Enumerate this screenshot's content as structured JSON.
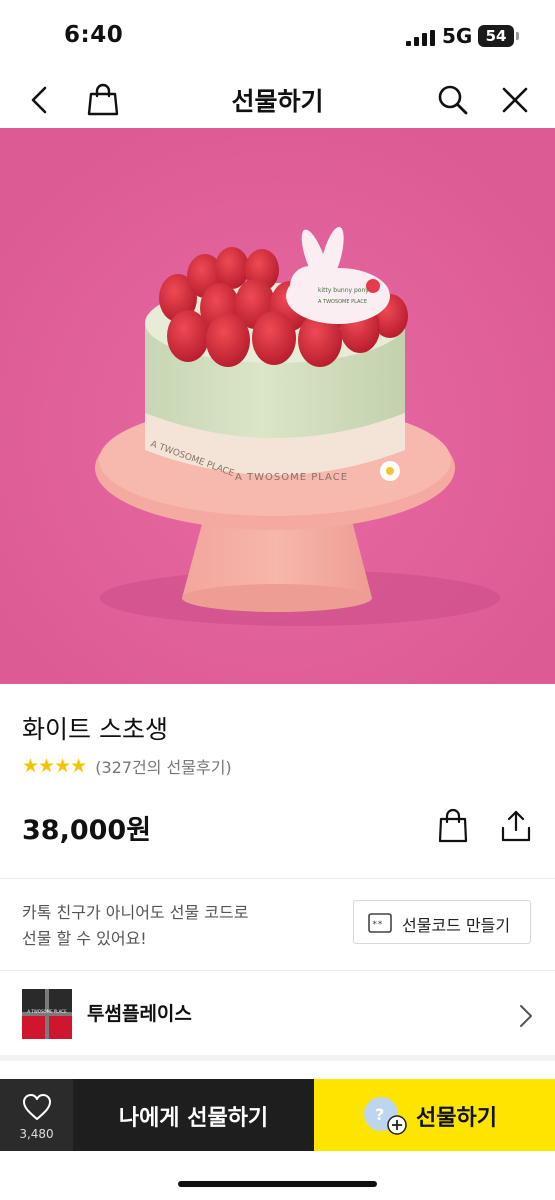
{
  "status_bar": {
    "time": "6:40",
    "network": "5G",
    "battery": "54"
  },
  "nav": {
    "title": "선물하기",
    "back_icon": "chevron-left-icon",
    "cart_icon": "shopping-bag-icon",
    "search_icon": "search-icon",
    "close_icon": "close-icon"
  },
  "hero": {
    "background_color": "#e2629b",
    "topper_text_1": "kitty bunny pony",
    "topper_text_2": "A TWOSOME PLACE",
    "ribbon_text_1": "A TWOSOME PLACE",
    "ribbon_text_2": "A TWOSOME PLACE"
  },
  "product": {
    "name": "화이트 스초생",
    "stars": "★★★★",
    "rating_value": 4,
    "review_text": "(327건의 선물후기)",
    "price": "38,000원"
  },
  "actions": {
    "cart_icon": "shopping-bag-icon",
    "share_icon": "share-icon"
  },
  "promo": {
    "line1": "카톡 친구가 아니어도 선물 코드로",
    "line2": "선물 할 수 있어요!",
    "code_button": "선물코드 만들기"
  },
  "brand": {
    "logo_text": "A TWOSOME PLACE",
    "name": "투썸플레이스"
  },
  "bottom_bar": {
    "like_icon": "heart-icon",
    "like_count": "3,480",
    "self_gift": "나에게 선물하기",
    "gift": "선물하기",
    "accent_color": "#fee500"
  }
}
